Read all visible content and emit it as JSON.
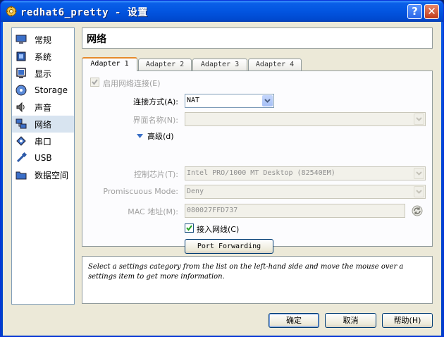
{
  "window": {
    "title": "redhat6_pretty - 设置",
    "help_glyph": "?",
    "close_glyph": "✕"
  },
  "sidebar": {
    "items": [
      {
        "label": "常规",
        "icon": "monitor-icon"
      },
      {
        "label": "系统",
        "icon": "chip-icon"
      },
      {
        "label": "显示",
        "icon": "display-icon"
      },
      {
        "label": "Storage",
        "icon": "disk-icon"
      },
      {
        "label": "声音",
        "icon": "speaker-icon"
      },
      {
        "label": "网络",
        "icon": "network-icon",
        "selected": true
      },
      {
        "label": "串口",
        "icon": "serial-port-icon"
      },
      {
        "label": "USB",
        "icon": "usb-icon"
      },
      {
        "label": "数据空间",
        "icon": "folder-icon"
      }
    ]
  },
  "header": {
    "title": "网络"
  },
  "tabs": [
    "Adapter 1",
    "Adapter 2",
    "Adapter 3",
    "Adapter 4"
  ],
  "adapter": {
    "enable_label": "启用网络连接(E)",
    "attached_label": "连接方式(A):",
    "attached_value": "NAT",
    "name_label": "界面名称(N):",
    "name_value": "",
    "advanced_label": "高级(d)",
    "chip_label": "控制芯片(T):",
    "chip_value": "Intel PRO/1000 MT Desktop (82540EM)",
    "promisc_label": "Promiscuous Mode:",
    "promisc_value": "Deny",
    "mac_label": "MAC 地址(M):",
    "mac_value": "080027FFD737",
    "cable_label": "接入网线(C)",
    "port_forwarding_label": "Port Forwarding"
  },
  "info": {
    "text": "Select a settings category from the list on the left-hand side and move the mouse over a settings item to get more information."
  },
  "buttons": {
    "ok": "确定",
    "cancel": "取消",
    "help": "帮助(H)"
  },
  "colors": {
    "accent_tab": "#e68b2c",
    "titlebar": "#0255e0",
    "selection": "#d8e4f0"
  }
}
